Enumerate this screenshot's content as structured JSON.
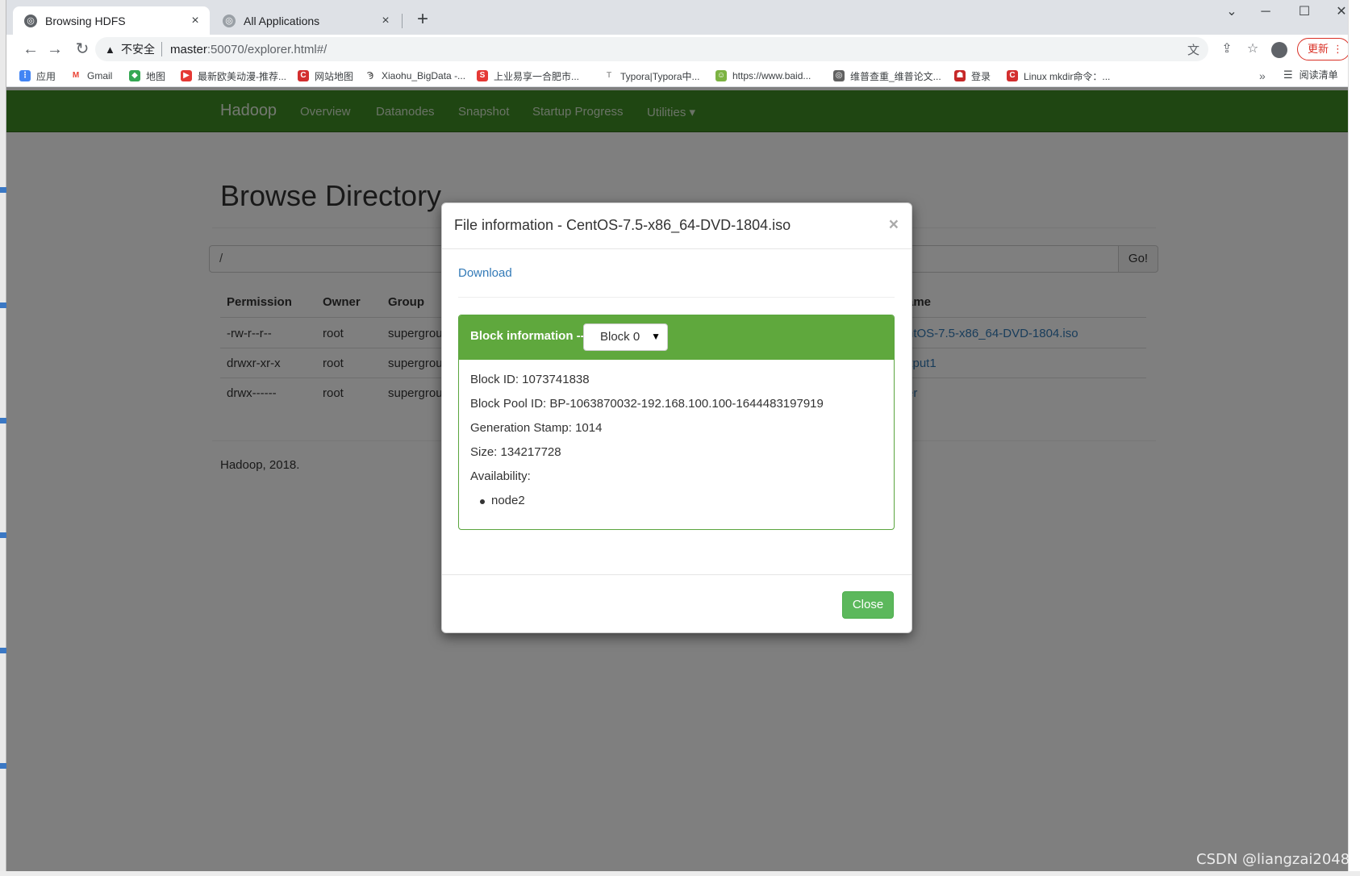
{
  "tabs": [
    {
      "title": "Browsing HDFS",
      "favicon": "globe-icon",
      "close": "×"
    },
    {
      "title": "All Applications",
      "favicon": "globe-icon",
      "close": "×"
    }
  ],
  "new_tab": "+",
  "window_controls": [
    "⌄",
    "─",
    "☐",
    "✕"
  ],
  "toolbar": {
    "back": "←",
    "forward": "→",
    "reload": "↻",
    "warning_icon": "▲",
    "insecure_label": "不安全",
    "url_host": "master",
    "url_path": ":50070/explorer.html#/",
    "translate_icon": "文",
    "share_icon": "⇪",
    "star_icon": "☆",
    "update_label": "更新",
    "menu_dots": "⋮"
  },
  "bookmarks": [
    {
      "label": "应用",
      "color": "#4285f4"
    },
    {
      "label": "Gmail",
      "color": "#ea4335"
    },
    {
      "label": "地图",
      "color": "#34a853"
    },
    {
      "label": "最新欧美动漫-推荐...",
      "color": "#e53935"
    },
    {
      "label": "网站地图",
      "color": "#d32f2f"
    },
    {
      "label": "Xiaohu_BigData -...",
      "color": "#555555"
    },
    {
      "label": "上业易享一合肥市...",
      "color": "#e53935"
    },
    {
      "label": "Typora|Typora中...",
      "color": "#9e9e9e"
    },
    {
      "label": "https://www.baid...",
      "color": "#7cb342"
    },
    {
      "label": "维普查重_维普论文...",
      "color": "#616161"
    },
    {
      "label": "登录",
      "color": "#c62828"
    },
    {
      "label": "Linux mkdir命令：...",
      "color": "#d32f2f"
    }
  ],
  "bookmarks_more": "»",
  "reading_list": "阅读清单",
  "navbar": {
    "brand": "Hadoop",
    "links": [
      "Overview",
      "Datanodes",
      "Snapshot",
      "Startup Progress",
      "Utilities ▾"
    ]
  },
  "page": {
    "title": "Browse Directory",
    "path_value": "/",
    "go_label": "Go!",
    "columns": [
      "Permission",
      "Owner",
      "Group",
      "Name"
    ],
    "name_header_visible": "ame",
    "rows": [
      {
        "permission": "-rw-r--r--",
        "owner": "root",
        "group": "supergrou",
        "name": "ntOS-7.5-x86_64-DVD-1804.iso"
      },
      {
        "permission": "drwxr-xr-x",
        "owner": "root",
        "group": "supergrou",
        "name": "itput1"
      },
      {
        "permission": "drwx------",
        "owner": "root",
        "group": "supergrou",
        "name": "er"
      }
    ],
    "footer": "Hadoop, 2018."
  },
  "modal": {
    "title": "File information - CentOS-7.5-x86_64-DVD-1804.iso",
    "close_x": "×",
    "download_label": "Download",
    "block_info_label": "Block information --",
    "block_selected": "Block 0",
    "block_id": "Block ID: 1073741838",
    "block_pool_id": "Block Pool ID: BP-1063870032-192.168.100.100-1644483197919",
    "generation_stamp": "Generation Stamp: 1014",
    "size": "Size: 134217728",
    "availability_label": "Availability:",
    "availability_nodes": [
      "node2"
    ],
    "close_button": "Close"
  },
  "watermark": "CSDN @liangzai2048",
  "colors": {
    "navbar": "#3f8c24",
    "panel_header": "#5fa83d",
    "close_button": "#5cb85c",
    "link": "#337ab7"
  }
}
